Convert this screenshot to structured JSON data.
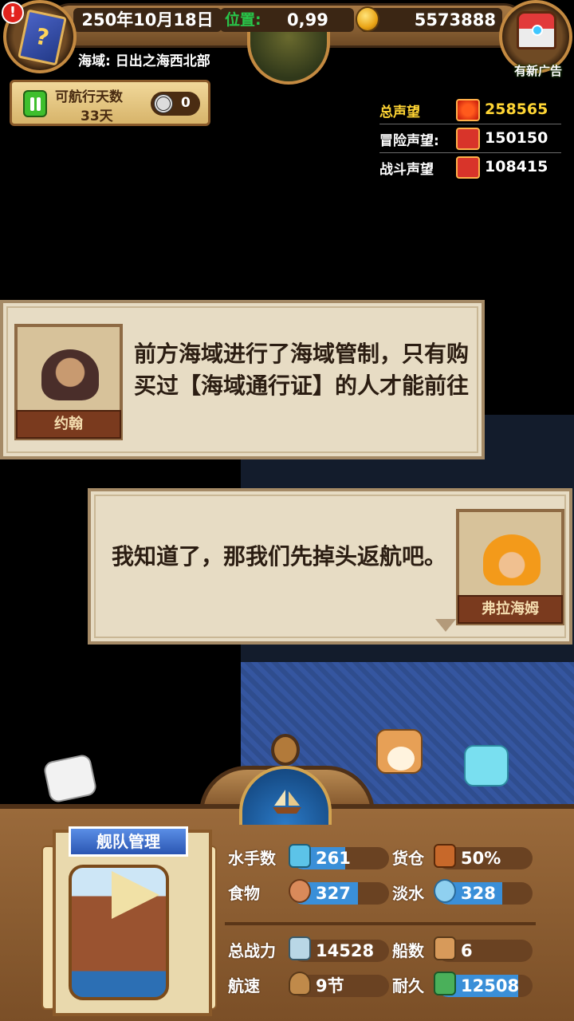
{
  "top_bar": {
    "date": "250年10月18日",
    "position_label": "位置:",
    "position_value": "0,99",
    "gold": "5573888",
    "alert": "!",
    "ad_label": "有新广告",
    "book_glyph": "?"
  },
  "region": "海域: 日出之海西北部",
  "sail_days": {
    "label": "可航行天数",
    "value": "33天",
    "ticket_count": "0"
  },
  "fame": {
    "total": {
      "label": "总声望",
      "value": "258565"
    },
    "adventure": {
      "label": "冒险声望:",
      "value": "150150"
    },
    "battle": {
      "label": "战斗声望",
      "value": "108415"
    }
  },
  "dialogs": [
    {
      "speaker": "约翰",
      "text": "前方海域进行了海域管制，只有购买过【海域通行证】的人才能前往"
    },
    {
      "speaker": "弗拉海姆",
      "text": "我知道了，那我们先掉头返航吧。"
    }
  ],
  "fleet": {
    "title": "舰队管理",
    "stats": {
      "sailors": {
        "label": "水手数",
        "value": "261",
        "fill": 0.55,
        "icon": "sailor-icon"
      },
      "cargo": {
        "label": "货仓",
        "value": "50%",
        "fill": 0.0,
        "icon": "cargo-icon"
      },
      "food": {
        "label": "食物",
        "value": "327",
        "fill": 0.68,
        "icon": "food-icon"
      },
      "water": {
        "label": "淡水",
        "value": "328",
        "fill": 0.68,
        "icon": "water-icon"
      },
      "power": {
        "label": "总战力",
        "value": "14528",
        "fill": 0.0,
        "icon": "power-icon"
      },
      "ships": {
        "label": "船数",
        "value": "6",
        "fill": 0.0,
        "icon": "ships-icon"
      },
      "speed": {
        "label": "航速",
        "value": "9节",
        "fill": 0.0,
        "icon": "speed-icon"
      },
      "durability": {
        "label": "耐久",
        "value": "12508",
        "fill": 0.85,
        "icon": "durability-icon"
      }
    }
  },
  "colors": {
    "fame_total": "#ffd534",
    "position_label": "#29c54a",
    "bar_fill": "#3a8fd8",
    "dialog_bg": "#e7dcc4"
  }
}
